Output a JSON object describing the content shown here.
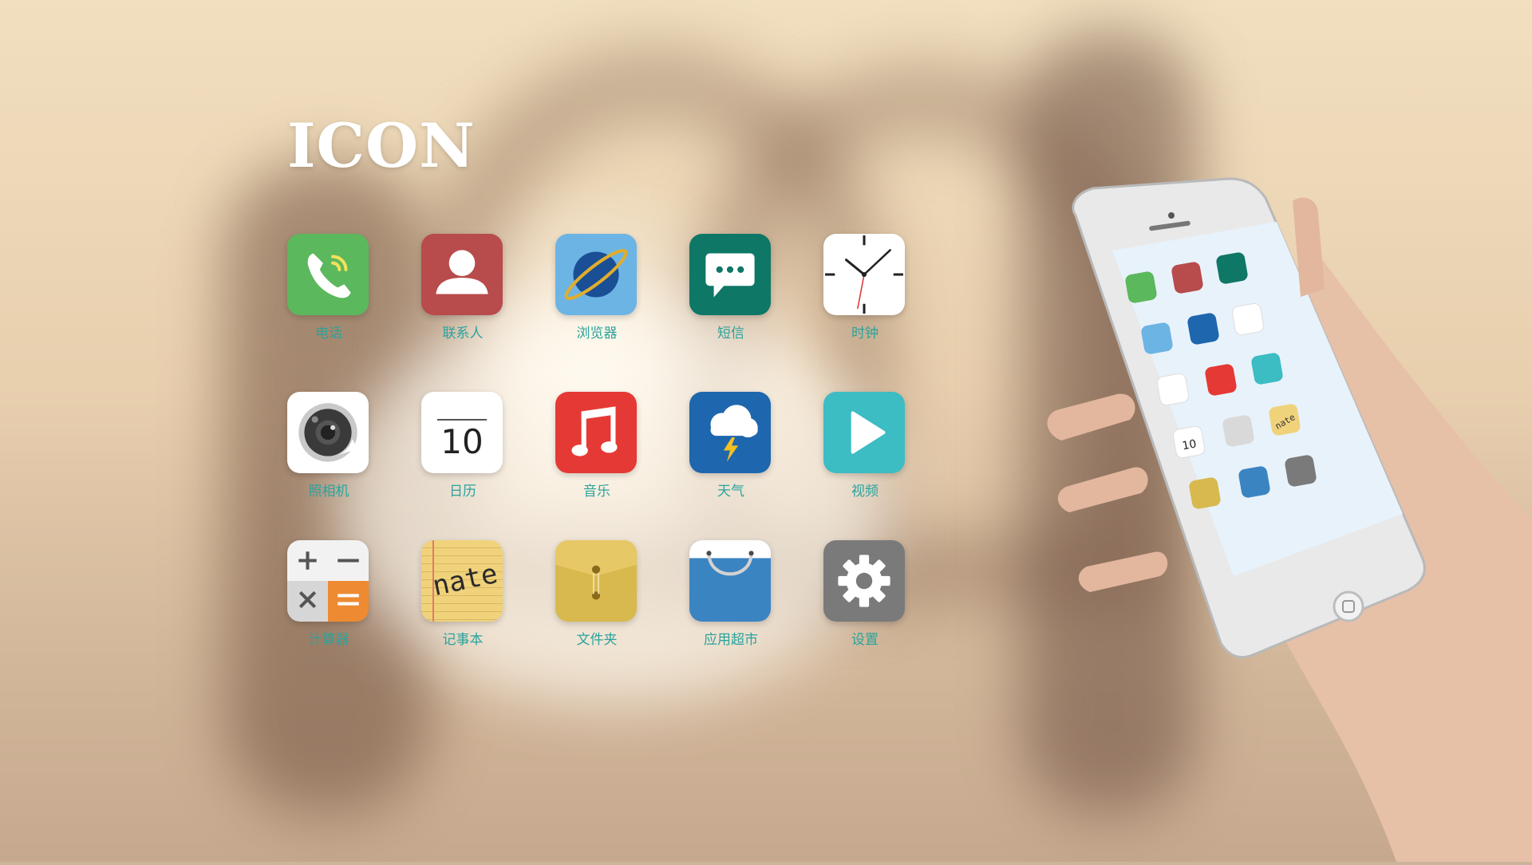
{
  "page": {
    "title": "ICON"
  },
  "apps": [
    {
      "label": "电话",
      "icon": "phone-icon",
      "color": "#5cb85c"
    },
    {
      "label": "联系人",
      "icon": "contacts-icon",
      "color": "#b84b4b"
    },
    {
      "label": "浏览器",
      "icon": "browser-icon",
      "color": "#6cb4e4"
    },
    {
      "label": "短信",
      "icon": "message-icon",
      "color": "#0e7766"
    },
    {
      "label": "时钟",
      "icon": "clock-icon",
      "color": "#ffffff"
    },
    {
      "label": "照相机",
      "icon": "camera-icon",
      "color": "#ffffff"
    },
    {
      "label": "日历",
      "icon": "calendar-icon",
      "color": "#ffffff",
      "day": "10"
    },
    {
      "label": "音乐",
      "icon": "music-icon",
      "color": "#e53935"
    },
    {
      "label": "天气",
      "icon": "weather-icon",
      "color": "#1e66ae"
    },
    {
      "label": "视频",
      "icon": "video-icon",
      "color": "#3cbcc3"
    },
    {
      "label": "计算器",
      "icon": "calculator-icon",
      "color": "#d9d9d9"
    },
    {
      "label": "记事本",
      "icon": "notepad-icon",
      "color": "#f0d27b",
      "note_text": "nate"
    },
    {
      "label": "文件夹",
      "icon": "folder-icon",
      "color": "#d8b94e"
    },
    {
      "label": "应用超市",
      "icon": "app-store-icon",
      "color": "#3b84c2"
    },
    {
      "label": "设置",
      "icon": "settings-icon",
      "color": "#7a7a7a"
    }
  ],
  "phone": {
    "calendar_day": "10",
    "note_text": "nate"
  }
}
